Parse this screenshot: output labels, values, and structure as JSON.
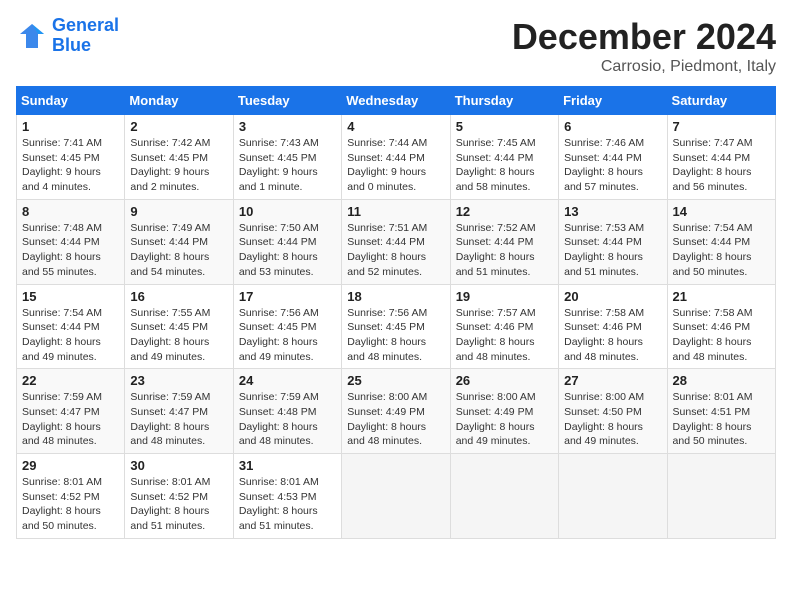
{
  "header": {
    "logo_line1": "General",
    "logo_line2": "Blue",
    "month_title": "December 2024",
    "location": "Carrosio, Piedmont, Italy"
  },
  "days_of_week": [
    "Sunday",
    "Monday",
    "Tuesday",
    "Wednesday",
    "Thursday",
    "Friday",
    "Saturday"
  ],
  "weeks": [
    [
      {
        "day": "1",
        "info": "Sunrise: 7:41 AM\nSunset: 4:45 PM\nDaylight: 9 hours\nand 4 minutes."
      },
      {
        "day": "2",
        "info": "Sunrise: 7:42 AM\nSunset: 4:45 PM\nDaylight: 9 hours\nand 2 minutes."
      },
      {
        "day": "3",
        "info": "Sunrise: 7:43 AM\nSunset: 4:45 PM\nDaylight: 9 hours\nand 1 minute."
      },
      {
        "day": "4",
        "info": "Sunrise: 7:44 AM\nSunset: 4:44 PM\nDaylight: 9 hours\nand 0 minutes."
      },
      {
        "day": "5",
        "info": "Sunrise: 7:45 AM\nSunset: 4:44 PM\nDaylight: 8 hours\nand 58 minutes."
      },
      {
        "day": "6",
        "info": "Sunrise: 7:46 AM\nSunset: 4:44 PM\nDaylight: 8 hours\nand 57 minutes."
      },
      {
        "day": "7",
        "info": "Sunrise: 7:47 AM\nSunset: 4:44 PM\nDaylight: 8 hours\nand 56 minutes."
      }
    ],
    [
      {
        "day": "8",
        "info": "Sunrise: 7:48 AM\nSunset: 4:44 PM\nDaylight: 8 hours\nand 55 minutes."
      },
      {
        "day": "9",
        "info": "Sunrise: 7:49 AM\nSunset: 4:44 PM\nDaylight: 8 hours\nand 54 minutes."
      },
      {
        "day": "10",
        "info": "Sunrise: 7:50 AM\nSunset: 4:44 PM\nDaylight: 8 hours\nand 53 minutes."
      },
      {
        "day": "11",
        "info": "Sunrise: 7:51 AM\nSunset: 4:44 PM\nDaylight: 8 hours\nand 52 minutes."
      },
      {
        "day": "12",
        "info": "Sunrise: 7:52 AM\nSunset: 4:44 PM\nDaylight: 8 hours\nand 51 minutes."
      },
      {
        "day": "13",
        "info": "Sunrise: 7:53 AM\nSunset: 4:44 PM\nDaylight: 8 hours\nand 51 minutes."
      },
      {
        "day": "14",
        "info": "Sunrise: 7:54 AM\nSunset: 4:44 PM\nDaylight: 8 hours\nand 50 minutes."
      }
    ],
    [
      {
        "day": "15",
        "info": "Sunrise: 7:54 AM\nSunset: 4:44 PM\nDaylight: 8 hours\nand 49 minutes."
      },
      {
        "day": "16",
        "info": "Sunrise: 7:55 AM\nSunset: 4:45 PM\nDaylight: 8 hours\nand 49 minutes."
      },
      {
        "day": "17",
        "info": "Sunrise: 7:56 AM\nSunset: 4:45 PM\nDaylight: 8 hours\nand 49 minutes."
      },
      {
        "day": "18",
        "info": "Sunrise: 7:56 AM\nSunset: 4:45 PM\nDaylight: 8 hours\nand 48 minutes."
      },
      {
        "day": "19",
        "info": "Sunrise: 7:57 AM\nSunset: 4:46 PM\nDaylight: 8 hours\nand 48 minutes."
      },
      {
        "day": "20",
        "info": "Sunrise: 7:58 AM\nSunset: 4:46 PM\nDaylight: 8 hours\nand 48 minutes."
      },
      {
        "day": "21",
        "info": "Sunrise: 7:58 AM\nSunset: 4:46 PM\nDaylight: 8 hours\nand 48 minutes."
      }
    ],
    [
      {
        "day": "22",
        "info": "Sunrise: 7:59 AM\nSunset: 4:47 PM\nDaylight: 8 hours\nand 48 minutes."
      },
      {
        "day": "23",
        "info": "Sunrise: 7:59 AM\nSunset: 4:47 PM\nDaylight: 8 hours\nand 48 minutes."
      },
      {
        "day": "24",
        "info": "Sunrise: 7:59 AM\nSunset: 4:48 PM\nDaylight: 8 hours\nand 48 minutes."
      },
      {
        "day": "25",
        "info": "Sunrise: 8:00 AM\nSunset: 4:49 PM\nDaylight: 8 hours\nand 48 minutes."
      },
      {
        "day": "26",
        "info": "Sunrise: 8:00 AM\nSunset: 4:49 PM\nDaylight: 8 hours\nand 49 minutes."
      },
      {
        "day": "27",
        "info": "Sunrise: 8:00 AM\nSunset: 4:50 PM\nDaylight: 8 hours\nand 49 minutes."
      },
      {
        "day": "28",
        "info": "Sunrise: 8:01 AM\nSunset: 4:51 PM\nDaylight: 8 hours\nand 50 minutes."
      }
    ],
    [
      {
        "day": "29",
        "info": "Sunrise: 8:01 AM\nSunset: 4:52 PM\nDaylight: 8 hours\nand 50 minutes."
      },
      {
        "day": "30",
        "info": "Sunrise: 8:01 AM\nSunset: 4:52 PM\nDaylight: 8 hours\nand 51 minutes."
      },
      {
        "day": "31",
        "info": "Sunrise: 8:01 AM\nSunset: 4:53 PM\nDaylight: 8 hours\nand 51 minutes."
      },
      null,
      null,
      null,
      null
    ]
  ]
}
